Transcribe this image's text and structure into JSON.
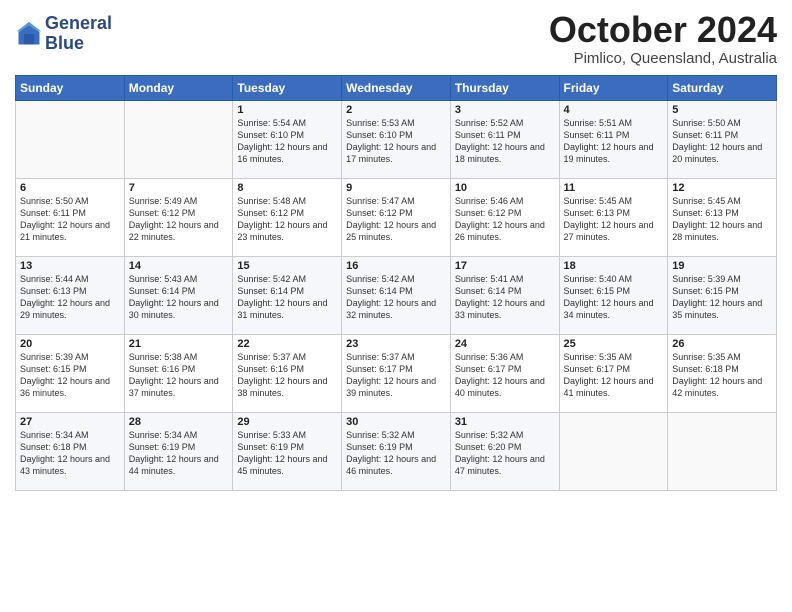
{
  "header": {
    "logo_line1": "General",
    "logo_line2": "Blue",
    "month_title": "October 2024",
    "subtitle": "Pimlico, Queensland, Australia"
  },
  "weekdays": [
    "Sunday",
    "Monday",
    "Tuesday",
    "Wednesday",
    "Thursday",
    "Friday",
    "Saturday"
  ],
  "weeks": [
    [
      {
        "day": "",
        "detail": ""
      },
      {
        "day": "",
        "detail": ""
      },
      {
        "day": "1",
        "detail": "Sunrise: 5:54 AM\nSunset: 6:10 PM\nDaylight: 12 hours\nand 16 minutes."
      },
      {
        "day": "2",
        "detail": "Sunrise: 5:53 AM\nSunset: 6:10 PM\nDaylight: 12 hours\nand 17 minutes."
      },
      {
        "day": "3",
        "detail": "Sunrise: 5:52 AM\nSunset: 6:11 PM\nDaylight: 12 hours\nand 18 minutes."
      },
      {
        "day": "4",
        "detail": "Sunrise: 5:51 AM\nSunset: 6:11 PM\nDaylight: 12 hours\nand 19 minutes."
      },
      {
        "day": "5",
        "detail": "Sunrise: 5:50 AM\nSunset: 6:11 PM\nDaylight: 12 hours\nand 20 minutes."
      }
    ],
    [
      {
        "day": "6",
        "detail": "Sunrise: 5:50 AM\nSunset: 6:11 PM\nDaylight: 12 hours\nand 21 minutes."
      },
      {
        "day": "7",
        "detail": "Sunrise: 5:49 AM\nSunset: 6:12 PM\nDaylight: 12 hours\nand 22 minutes."
      },
      {
        "day": "8",
        "detail": "Sunrise: 5:48 AM\nSunset: 6:12 PM\nDaylight: 12 hours\nand 23 minutes."
      },
      {
        "day": "9",
        "detail": "Sunrise: 5:47 AM\nSunset: 6:12 PM\nDaylight: 12 hours\nand 25 minutes."
      },
      {
        "day": "10",
        "detail": "Sunrise: 5:46 AM\nSunset: 6:12 PM\nDaylight: 12 hours\nand 26 minutes."
      },
      {
        "day": "11",
        "detail": "Sunrise: 5:45 AM\nSunset: 6:13 PM\nDaylight: 12 hours\nand 27 minutes."
      },
      {
        "day": "12",
        "detail": "Sunrise: 5:45 AM\nSunset: 6:13 PM\nDaylight: 12 hours\nand 28 minutes."
      }
    ],
    [
      {
        "day": "13",
        "detail": "Sunrise: 5:44 AM\nSunset: 6:13 PM\nDaylight: 12 hours\nand 29 minutes."
      },
      {
        "day": "14",
        "detail": "Sunrise: 5:43 AM\nSunset: 6:14 PM\nDaylight: 12 hours\nand 30 minutes."
      },
      {
        "day": "15",
        "detail": "Sunrise: 5:42 AM\nSunset: 6:14 PM\nDaylight: 12 hours\nand 31 minutes."
      },
      {
        "day": "16",
        "detail": "Sunrise: 5:42 AM\nSunset: 6:14 PM\nDaylight: 12 hours\nand 32 minutes."
      },
      {
        "day": "17",
        "detail": "Sunrise: 5:41 AM\nSunset: 6:14 PM\nDaylight: 12 hours\nand 33 minutes."
      },
      {
        "day": "18",
        "detail": "Sunrise: 5:40 AM\nSunset: 6:15 PM\nDaylight: 12 hours\nand 34 minutes."
      },
      {
        "day": "19",
        "detail": "Sunrise: 5:39 AM\nSunset: 6:15 PM\nDaylight: 12 hours\nand 35 minutes."
      }
    ],
    [
      {
        "day": "20",
        "detail": "Sunrise: 5:39 AM\nSunset: 6:15 PM\nDaylight: 12 hours\nand 36 minutes."
      },
      {
        "day": "21",
        "detail": "Sunrise: 5:38 AM\nSunset: 6:16 PM\nDaylight: 12 hours\nand 37 minutes."
      },
      {
        "day": "22",
        "detail": "Sunrise: 5:37 AM\nSunset: 6:16 PM\nDaylight: 12 hours\nand 38 minutes."
      },
      {
        "day": "23",
        "detail": "Sunrise: 5:37 AM\nSunset: 6:17 PM\nDaylight: 12 hours\nand 39 minutes."
      },
      {
        "day": "24",
        "detail": "Sunrise: 5:36 AM\nSunset: 6:17 PM\nDaylight: 12 hours\nand 40 minutes."
      },
      {
        "day": "25",
        "detail": "Sunrise: 5:35 AM\nSunset: 6:17 PM\nDaylight: 12 hours\nand 41 minutes."
      },
      {
        "day": "26",
        "detail": "Sunrise: 5:35 AM\nSunset: 6:18 PM\nDaylight: 12 hours\nand 42 minutes."
      }
    ],
    [
      {
        "day": "27",
        "detail": "Sunrise: 5:34 AM\nSunset: 6:18 PM\nDaylight: 12 hours\nand 43 minutes."
      },
      {
        "day": "28",
        "detail": "Sunrise: 5:34 AM\nSunset: 6:19 PM\nDaylight: 12 hours\nand 44 minutes."
      },
      {
        "day": "29",
        "detail": "Sunrise: 5:33 AM\nSunset: 6:19 PM\nDaylight: 12 hours\nand 45 minutes."
      },
      {
        "day": "30",
        "detail": "Sunrise: 5:32 AM\nSunset: 6:19 PM\nDaylight: 12 hours\nand 46 minutes."
      },
      {
        "day": "31",
        "detail": "Sunrise: 5:32 AM\nSunset: 6:20 PM\nDaylight: 12 hours\nand 47 minutes."
      },
      {
        "day": "",
        "detail": ""
      },
      {
        "day": "",
        "detail": ""
      }
    ]
  ]
}
